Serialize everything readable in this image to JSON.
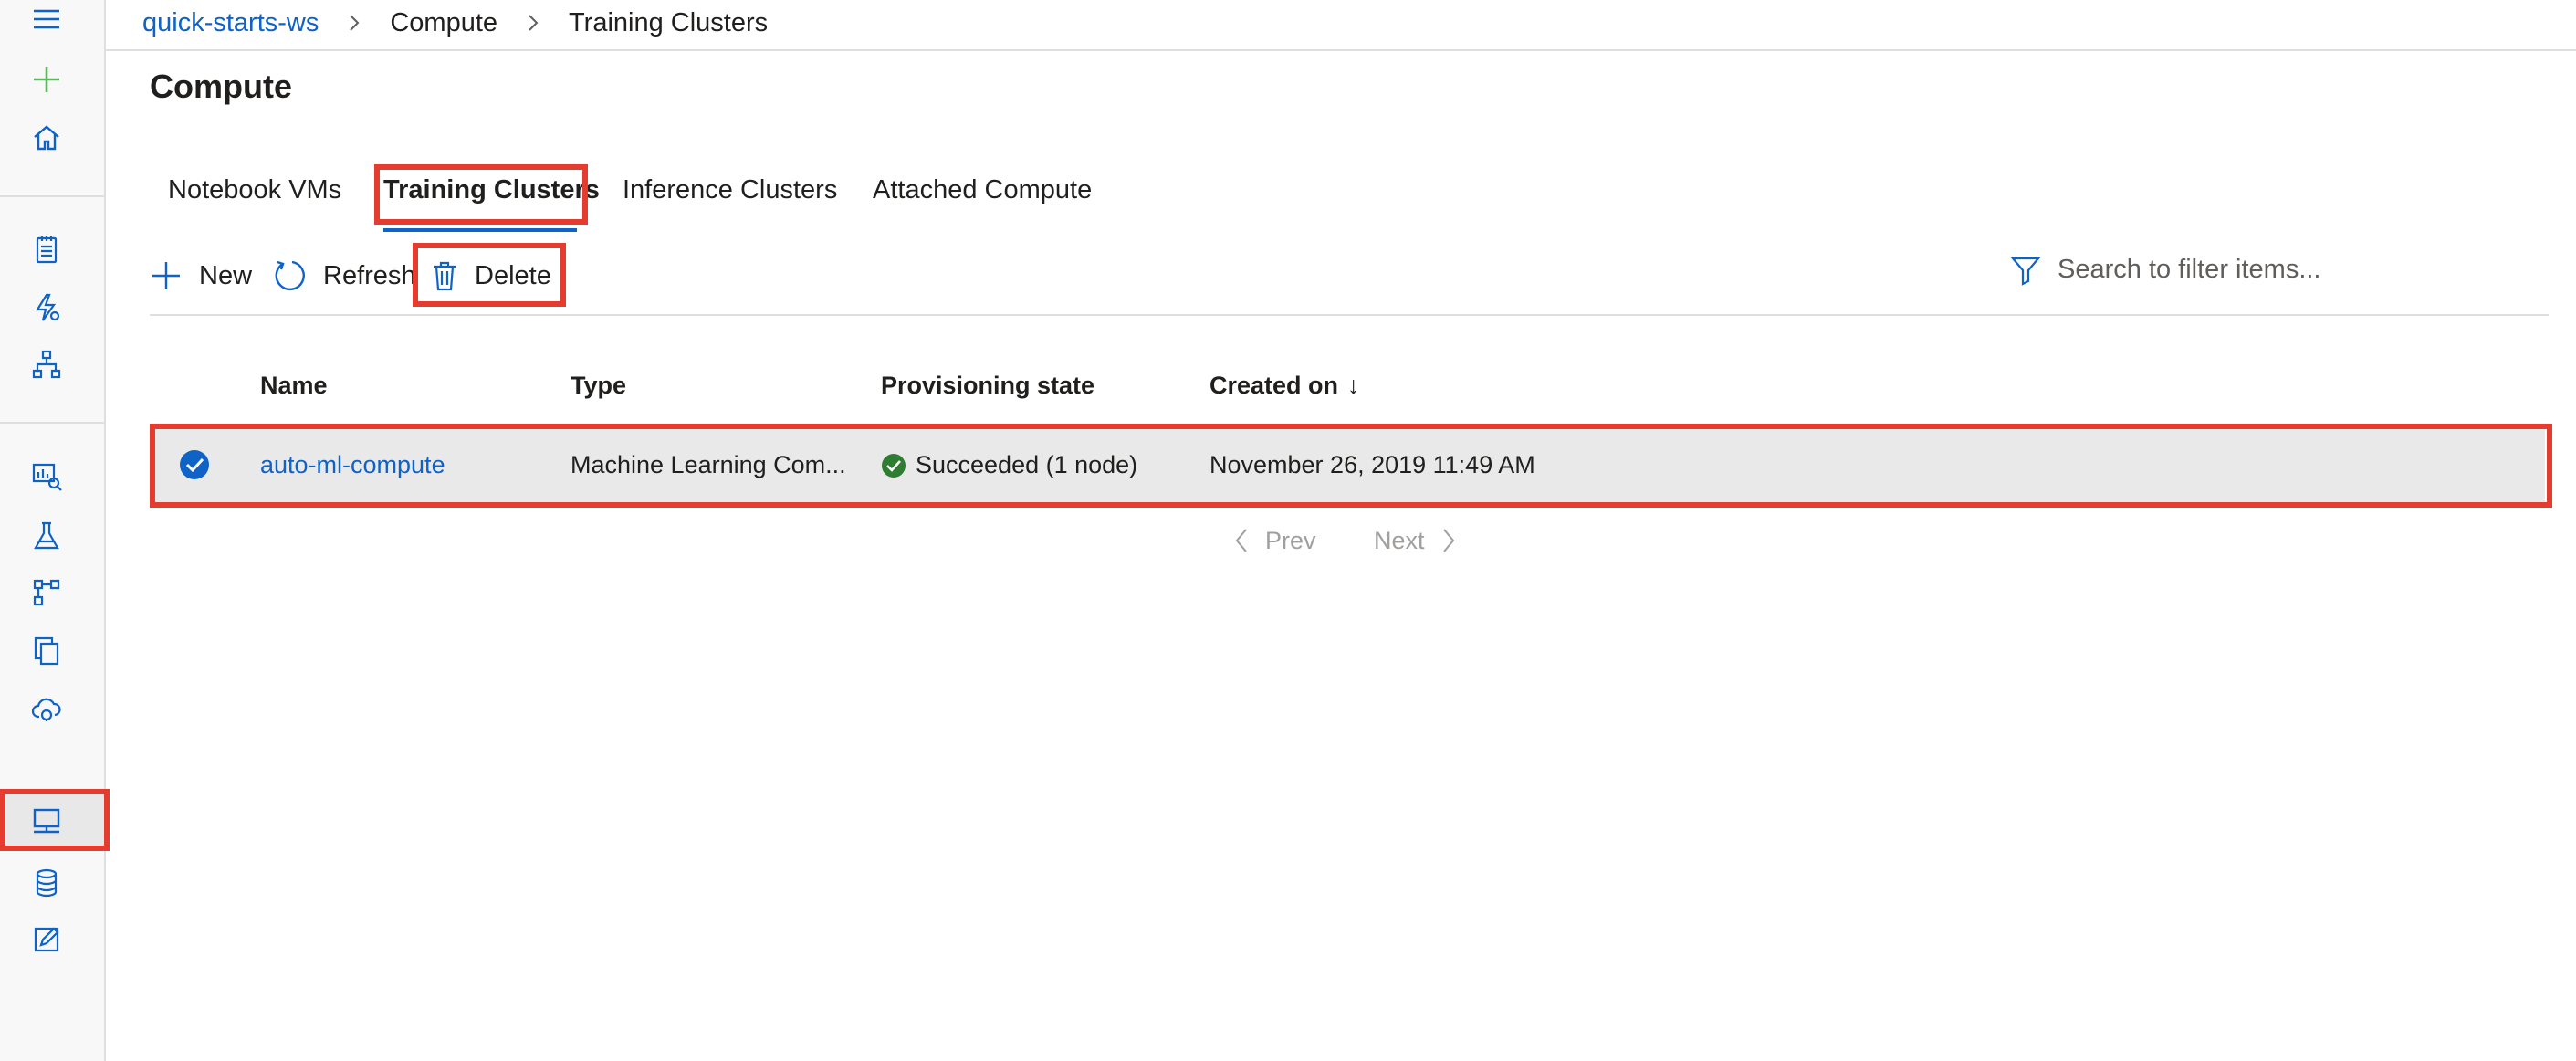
{
  "breadcrumb": {
    "workspace": "quick-starts-ws",
    "section": "Compute",
    "current": "Training Clusters"
  },
  "page": {
    "title": "Compute"
  },
  "tabs": [
    {
      "label": "Notebook VMs",
      "active": false
    },
    {
      "label": "Training Clusters",
      "active": true
    },
    {
      "label": "Inference Clusters",
      "active": false
    },
    {
      "label": "Attached Compute",
      "active": false
    }
  ],
  "toolbar": {
    "new_label": "New",
    "refresh_label": "Refresh",
    "delete_label": "Delete",
    "search_placeholder": "Search to filter items..."
  },
  "table": {
    "columns": [
      "Name",
      "Type",
      "Provisioning state",
      "Created on"
    ],
    "sort_indicator": "↓",
    "rows": [
      {
        "selected": true,
        "name": "auto-ml-compute",
        "type": "Machine Learning Com...",
        "state": "Succeeded (1 node)",
        "created": "November 26, 2019 11:49 AM"
      }
    ]
  },
  "pager": {
    "prev": "Prev",
    "next": "Next"
  },
  "rail": {
    "icons": [
      "menu-icon",
      "create-plus-icon",
      "home-icon",
      "notebooks-icon",
      "automated-ml-icon",
      "designer-icon",
      "datasets-icon",
      "experiments-icon",
      "pipelines-icon",
      "models-icon",
      "endpoints-icon",
      "compute-icon",
      "datastores-icon",
      "data-labeling-icon"
    ],
    "selected": "compute-icon"
  },
  "colors": {
    "accent": "#0f62c6",
    "highlight": "#e43c2f",
    "success": "#2f7d32",
    "plus": "#5cb85c"
  }
}
